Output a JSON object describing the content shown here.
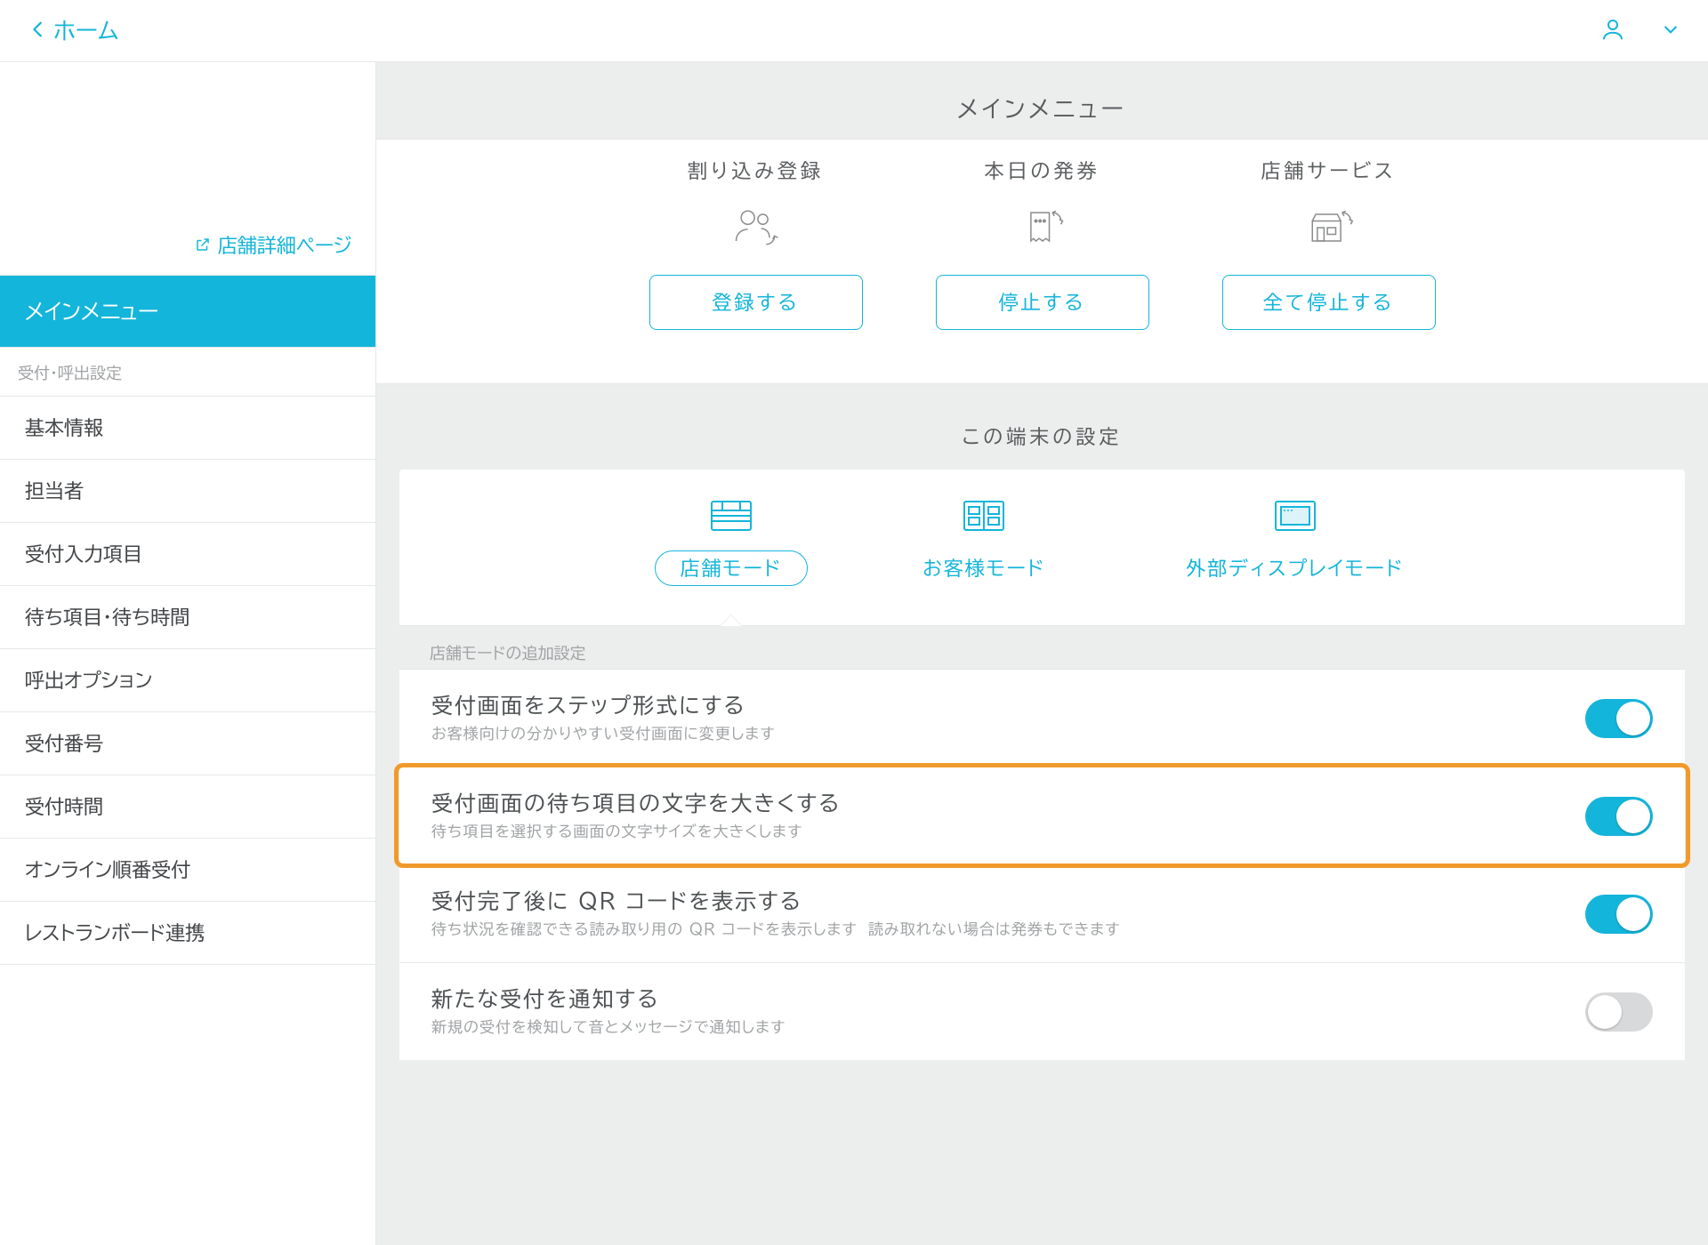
{
  "nav": {
    "back_label": "ホーム"
  },
  "sidebar": {
    "shop_detail_link": "店舗詳細ページ",
    "items": [
      "メインメニュー"
    ],
    "section_label": "受付・呼出設定",
    "section_items": [
      "基本情報",
      "担当者",
      "受付入力項目",
      "待ち項目・待ち時間",
      "呼出オプション",
      "受付番号",
      "受付時間",
      "オンライン順番受付",
      "レストランボード連携"
    ]
  },
  "content": {
    "main_menu_title": "メインメニュー",
    "actions": [
      {
        "label": "割り込み登録",
        "button": "登録する",
        "icon": "people-cycle"
      },
      {
        "label": "本日の発券",
        "button": "停止する",
        "icon": "receipt-cycle"
      },
      {
        "label": "店舗サービス",
        "button": "全て停止する",
        "icon": "store-cycle"
      }
    ],
    "terminal_title": "この端末の設定",
    "modes": [
      {
        "label": "店舗モード",
        "icon": "mode-store",
        "active": true
      },
      {
        "label": "お客様モード",
        "icon": "mode-customer",
        "active": false
      },
      {
        "label": "外部ディスプレイモード",
        "icon": "mode-display",
        "active": false
      }
    ],
    "mode_subhead": "店舗モードの追加設定",
    "settings": [
      {
        "title": "受付画面をステップ形式にする",
        "desc": "お客様向けの分かりやすい受付画面に変更します",
        "on": true,
        "highlight": false
      },
      {
        "title": "受付画面の待ち項目の文字を大きくする",
        "desc": "待ち項目を選択する画面の文字サイズを大きくします",
        "on": true,
        "highlight": true
      },
      {
        "title": "受付完了後に QR コードを表示する",
        "desc": "待ち状況を確認できる読み取り用の QR コードを表示します　読み取れない場合は発券もできます",
        "on": true,
        "highlight": false
      },
      {
        "title": "新たな受付を通知する",
        "desc": "新規の受付を検知して音とメッセージで通知します",
        "on": false,
        "highlight": false
      }
    ]
  }
}
